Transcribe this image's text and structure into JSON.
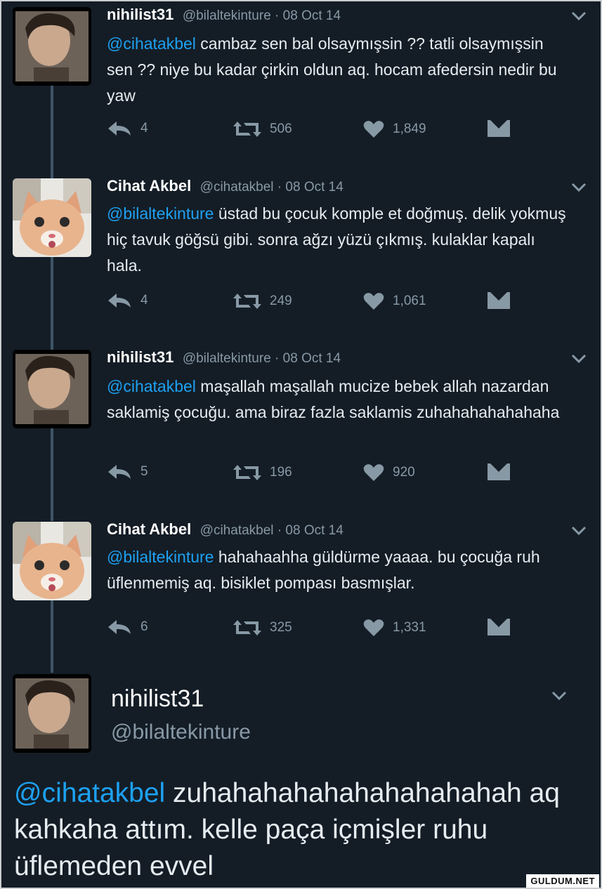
{
  "tweets": [
    {
      "name": "nihilist31",
      "handle": "@bilaltekinture",
      "date": "08 Oct 14",
      "mention": "@cihatakbel",
      "text": " cambaz sen bal olsaymışsin ?? tatli olsaymışsin sen ?? niye bu kadar çirkin oldun aq. hocam afedersin nedir bu yaw",
      "replies": "4",
      "retweets": "506",
      "likes": "1,849"
    },
    {
      "name": "Cihat Akbel",
      "handle": "@cihatakbel",
      "date": "08 Oct 14",
      "mention": "@bilaltekinture",
      "text": " üstad bu çocuk komple et doğmuş. delik yokmuş hiç tavuk göğsü gibi. sonra ağzı yüzü çıkmış. kulaklar kapalı hala.",
      "replies": "4",
      "retweets": "249",
      "likes": "1,061"
    },
    {
      "name": "nihilist31",
      "handle": "@bilaltekinture",
      "date": "08 Oct 14",
      "mention": "@cihatakbel",
      "text": " maşallah maşallah mucize bebek allah nazardan saklamiş çocuğu. ama biraz fazla saklamis zuhahahahahahaha",
      "replies": "5",
      "retweets": "196",
      "likes": "920"
    },
    {
      "name": "Cihat Akbel",
      "handle": "@cihatakbel",
      "date": "08 Oct 14",
      "mention": "@bilaltekinture",
      "text": " hahahaahha güldürme yaaaa. bu çocuğa ruh üflenmemiş aq. bisiklet pompası basmışlar.",
      "replies": "6",
      "retweets": "325",
      "likes": "1,331"
    }
  ],
  "main_tweet": {
    "name": "nihilist31",
    "handle": "@bilaltekinture",
    "mention": "@cihatakbel",
    "text": " zuhahahahahahahahahahah aq kahkaha attım. kelle paça içmişler ruhu üflemeden evvel"
  },
  "date_separator": " · ",
  "watermark": "GULDUM.NET",
  "colors": {
    "background": "#141d26",
    "mention": "#1da1f2",
    "secondary": "#8899a6"
  },
  "icons": [
    "reply-icon",
    "retweet-icon",
    "heart-icon",
    "direct-message-icon",
    "chevron-down-icon"
  ]
}
